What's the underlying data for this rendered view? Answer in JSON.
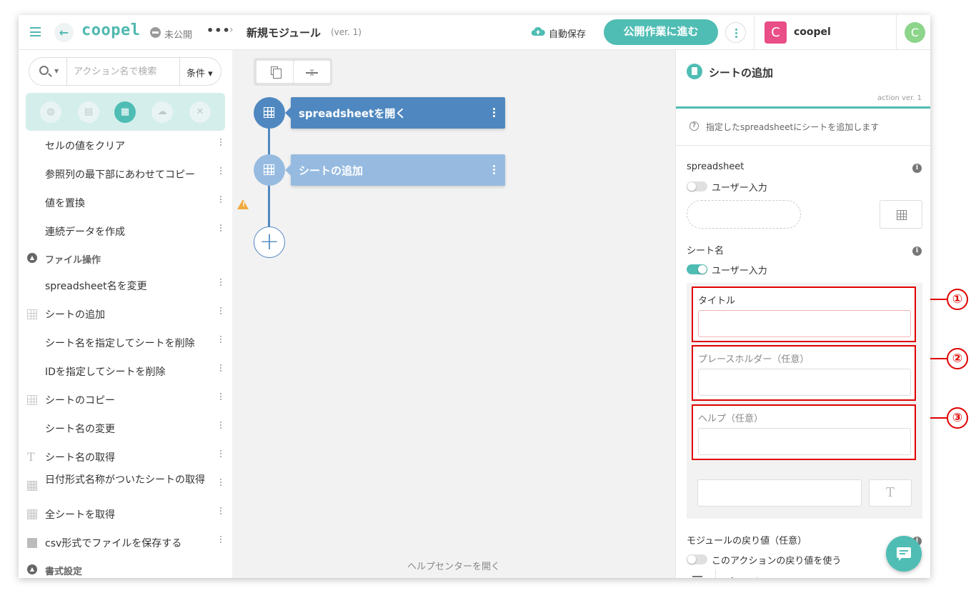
{
  "header": {
    "logo": "coopel",
    "status": "未公開",
    "more": "•••",
    "breadcrumb_sep": "›",
    "module_title": "新規モジュール",
    "module_version": "(ver. 1)",
    "autosave": "自動保存",
    "publish_button": "公開作業に進む",
    "org_initial": "C",
    "org_name": "coopel",
    "user_initial": "C"
  },
  "sidebar": {
    "search_placeholder": "アクション名で検索",
    "condition": "条件 ▾",
    "items": [
      {
        "label": "セルの値をクリア",
        "icon": "none"
      },
      {
        "label": "参照列の最下部にあわせてコピー",
        "icon": "none"
      },
      {
        "label": "値を置換",
        "icon": "none"
      },
      {
        "label": "連続データを作成",
        "icon": "none"
      }
    ],
    "section_file": "ファイル操作",
    "file_items": [
      {
        "label": "spreadsheet名を変更",
        "icon": "none"
      },
      {
        "label": "シートの追加",
        "icon": "grid-icon"
      },
      {
        "label": "シート名を指定してシートを削除",
        "icon": "none"
      },
      {
        "label": "IDを指定してシートを削除",
        "icon": "none"
      },
      {
        "label": "シートのコピー",
        "icon": "grid-icon"
      },
      {
        "label": "シート名の変更",
        "icon": "none"
      },
      {
        "label": "シート名の取得",
        "icon": "text-icon"
      },
      {
        "label": "日付形式名称がついたシートの取得",
        "icon": "grid-icon"
      },
      {
        "label": "全シートを取得",
        "icon": "grid-icon"
      },
      {
        "label": "csv形式でファイルを保存する",
        "icon": "document-icon"
      }
    ],
    "section_format": "書式設定"
  },
  "canvas": {
    "nodes": [
      {
        "label": "spreadsheetを開く",
        "color": "#4f88c0"
      },
      {
        "label": "シートの追加",
        "color": "#97bbe0"
      }
    ],
    "help_link": "ヘルプセンターを開く"
  },
  "panel": {
    "title": "シートの追加",
    "version": "action ver. 1",
    "description": "指定したspreadsheetにシートを追加します",
    "spreadsheet_label": "spreadsheet",
    "user_input": "ユーザー入力",
    "sheet_name_label": "シート名",
    "fields": [
      {
        "label": "タイトル",
        "value": ""
      },
      {
        "label": "プレースホルダー（任意）",
        "value": ""
      },
      {
        "label": "ヘルプ（任意）",
        "value": ""
      }
    ],
    "return_label": "モジュールの戻り値（任意）",
    "use_return": "このアクションの戻り値を使う"
  },
  "annotations": [
    "①",
    "②",
    "③"
  ],
  "colors": {
    "accent": "#4fbdb4",
    "node_primary": "#4f88c0",
    "node_secondary": "#97bbe0",
    "annotation": "#e00000",
    "org": "#e94e86"
  }
}
